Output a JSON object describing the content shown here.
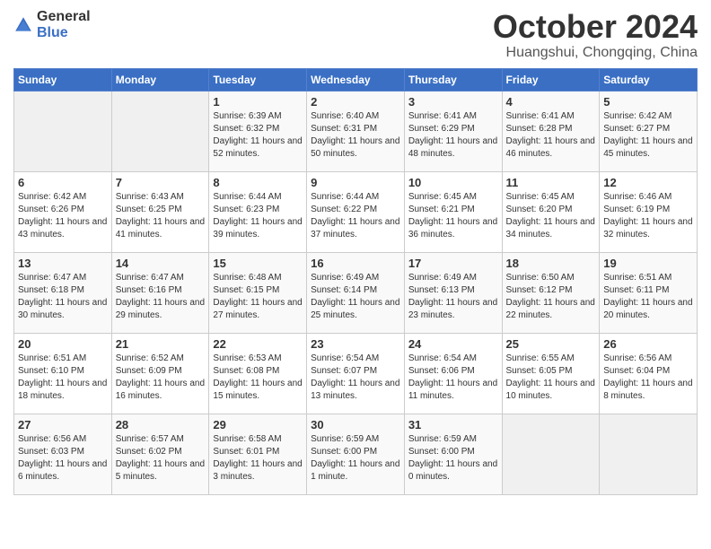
{
  "logo": {
    "general": "General",
    "blue": "Blue"
  },
  "title": "October 2024",
  "location": "Huangshui, Chongqing, China",
  "days_header": [
    "Sunday",
    "Monday",
    "Tuesday",
    "Wednesday",
    "Thursday",
    "Friday",
    "Saturday"
  ],
  "weeks": [
    [
      {
        "num": "",
        "empty": true
      },
      {
        "num": "",
        "empty": true
      },
      {
        "num": "1",
        "sunrise": "6:39 AM",
        "sunset": "6:32 PM",
        "daylight": "11 hours and 52 minutes."
      },
      {
        "num": "2",
        "sunrise": "6:40 AM",
        "sunset": "6:31 PM",
        "daylight": "11 hours and 50 minutes."
      },
      {
        "num": "3",
        "sunrise": "6:41 AM",
        "sunset": "6:29 PM",
        "daylight": "11 hours and 48 minutes."
      },
      {
        "num": "4",
        "sunrise": "6:41 AM",
        "sunset": "6:28 PM",
        "daylight": "11 hours and 46 minutes."
      },
      {
        "num": "5",
        "sunrise": "6:42 AM",
        "sunset": "6:27 PM",
        "daylight": "11 hours and 45 minutes."
      }
    ],
    [
      {
        "num": "6",
        "sunrise": "6:42 AM",
        "sunset": "6:26 PM",
        "daylight": "11 hours and 43 minutes."
      },
      {
        "num": "7",
        "sunrise": "6:43 AM",
        "sunset": "6:25 PM",
        "daylight": "11 hours and 41 minutes."
      },
      {
        "num": "8",
        "sunrise": "6:44 AM",
        "sunset": "6:23 PM",
        "daylight": "11 hours and 39 minutes."
      },
      {
        "num": "9",
        "sunrise": "6:44 AM",
        "sunset": "6:22 PM",
        "daylight": "11 hours and 37 minutes."
      },
      {
        "num": "10",
        "sunrise": "6:45 AM",
        "sunset": "6:21 PM",
        "daylight": "11 hours and 36 minutes."
      },
      {
        "num": "11",
        "sunrise": "6:45 AM",
        "sunset": "6:20 PM",
        "daylight": "11 hours and 34 minutes."
      },
      {
        "num": "12",
        "sunrise": "6:46 AM",
        "sunset": "6:19 PM",
        "daylight": "11 hours and 32 minutes."
      }
    ],
    [
      {
        "num": "13",
        "sunrise": "6:47 AM",
        "sunset": "6:18 PM",
        "daylight": "11 hours and 30 minutes."
      },
      {
        "num": "14",
        "sunrise": "6:47 AM",
        "sunset": "6:16 PM",
        "daylight": "11 hours and 29 minutes."
      },
      {
        "num": "15",
        "sunrise": "6:48 AM",
        "sunset": "6:15 PM",
        "daylight": "11 hours and 27 minutes."
      },
      {
        "num": "16",
        "sunrise": "6:49 AM",
        "sunset": "6:14 PM",
        "daylight": "11 hours and 25 minutes."
      },
      {
        "num": "17",
        "sunrise": "6:49 AM",
        "sunset": "6:13 PM",
        "daylight": "11 hours and 23 minutes."
      },
      {
        "num": "18",
        "sunrise": "6:50 AM",
        "sunset": "6:12 PM",
        "daylight": "11 hours and 22 minutes."
      },
      {
        "num": "19",
        "sunrise": "6:51 AM",
        "sunset": "6:11 PM",
        "daylight": "11 hours and 20 minutes."
      }
    ],
    [
      {
        "num": "20",
        "sunrise": "6:51 AM",
        "sunset": "6:10 PM",
        "daylight": "11 hours and 18 minutes."
      },
      {
        "num": "21",
        "sunrise": "6:52 AM",
        "sunset": "6:09 PM",
        "daylight": "11 hours and 16 minutes."
      },
      {
        "num": "22",
        "sunrise": "6:53 AM",
        "sunset": "6:08 PM",
        "daylight": "11 hours and 15 minutes."
      },
      {
        "num": "23",
        "sunrise": "6:54 AM",
        "sunset": "6:07 PM",
        "daylight": "11 hours and 13 minutes."
      },
      {
        "num": "24",
        "sunrise": "6:54 AM",
        "sunset": "6:06 PM",
        "daylight": "11 hours and 11 minutes."
      },
      {
        "num": "25",
        "sunrise": "6:55 AM",
        "sunset": "6:05 PM",
        "daylight": "11 hours and 10 minutes."
      },
      {
        "num": "26",
        "sunrise": "6:56 AM",
        "sunset": "6:04 PM",
        "daylight": "11 hours and 8 minutes."
      }
    ],
    [
      {
        "num": "27",
        "sunrise": "6:56 AM",
        "sunset": "6:03 PM",
        "daylight": "11 hours and 6 minutes."
      },
      {
        "num": "28",
        "sunrise": "6:57 AM",
        "sunset": "6:02 PM",
        "daylight": "11 hours and 5 minutes."
      },
      {
        "num": "29",
        "sunrise": "6:58 AM",
        "sunset": "6:01 PM",
        "daylight": "11 hours and 3 minutes."
      },
      {
        "num": "30",
        "sunrise": "6:59 AM",
        "sunset": "6:00 PM",
        "daylight": "11 hours and 1 minute."
      },
      {
        "num": "31",
        "sunrise": "6:59 AM",
        "sunset": "6:00 PM",
        "daylight": "11 hours and 0 minutes."
      },
      {
        "num": "",
        "empty": true
      },
      {
        "num": "",
        "empty": true
      }
    ]
  ],
  "labels": {
    "sunrise": "Sunrise:",
    "sunset": "Sunset:",
    "daylight": "Daylight:"
  }
}
